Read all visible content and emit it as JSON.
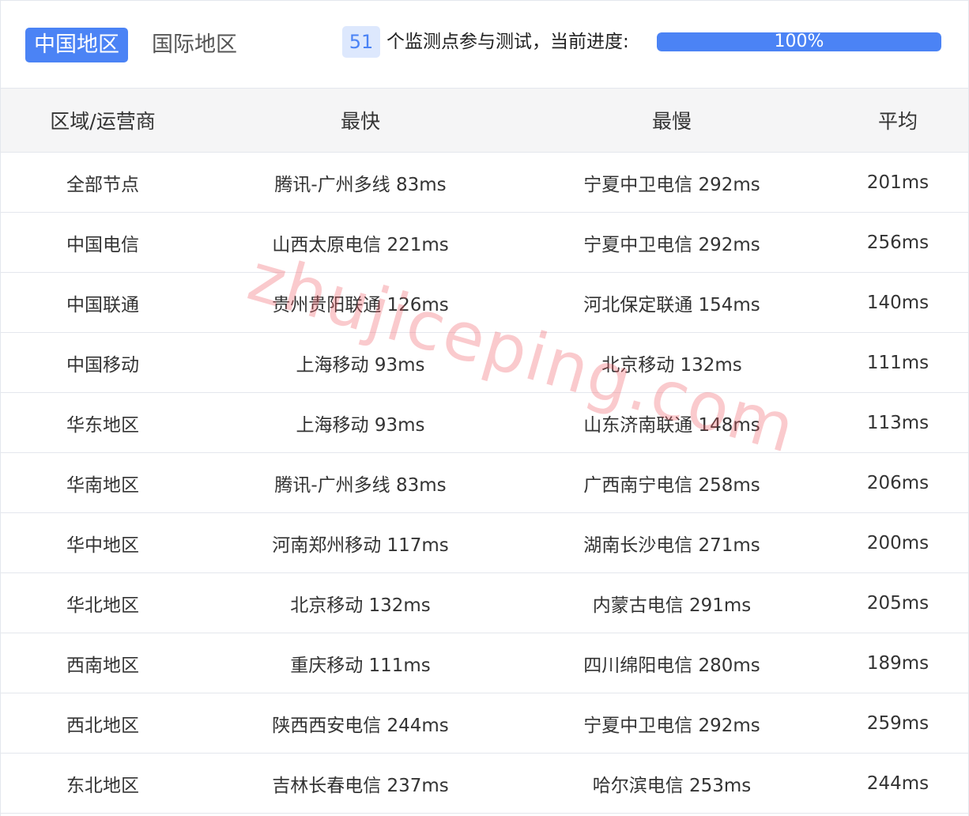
{
  "tabs": {
    "china_label": "中国地区",
    "international_label": "国际地区"
  },
  "status": {
    "monitor_count": "51",
    "text": "个监测点参与测试，当前进度:",
    "progress_percent": 100,
    "progress_label": "100%"
  },
  "table": {
    "headers": [
      "区域/运营商",
      "最快",
      "最慢",
      "平均"
    ],
    "rows": [
      {
        "region": "全部节点",
        "fastest": "腾讯-广州多线 83ms",
        "slowest": "宁夏中卫电信 292ms",
        "average": "201ms"
      },
      {
        "region": "中国电信",
        "fastest": "山西太原电信 221ms",
        "slowest": "宁夏中卫电信 292ms",
        "average": "256ms"
      },
      {
        "region": "中国联通",
        "fastest": "贵州贵阳联通 126ms",
        "slowest": "河北保定联通 154ms",
        "average": "140ms"
      },
      {
        "region": "中国移动",
        "fastest": "上海移动 93ms",
        "slowest": "北京移动 132ms",
        "average": "111ms"
      },
      {
        "region": "华东地区",
        "fastest": "上海移动 93ms",
        "slowest": "山东济南联通 148ms",
        "average": "113ms"
      },
      {
        "region": "华南地区",
        "fastest": "腾讯-广州多线 83ms",
        "slowest": "广西南宁电信 258ms",
        "average": "206ms"
      },
      {
        "region": "华中地区",
        "fastest": "河南郑州移动 117ms",
        "slowest": "湖南长沙电信 271ms",
        "average": "200ms"
      },
      {
        "region": "华北地区",
        "fastest": "北京移动 132ms",
        "slowest": "内蒙古电信 291ms",
        "average": "205ms"
      },
      {
        "region": "西南地区",
        "fastest": "重庆移动 111ms",
        "slowest": "四川绵阳电信 280ms",
        "average": "189ms"
      },
      {
        "region": "西北地区",
        "fastest": "陕西西安电信 244ms",
        "slowest": "宁夏中卫电信 292ms",
        "average": "259ms"
      },
      {
        "region": "东北地区",
        "fastest": "吉林长春电信 237ms",
        "slowest": "哈尔滨电信 253ms",
        "average": "244ms"
      }
    ]
  },
  "watermark": "zhujiceping.com",
  "colors": {
    "accent": "#4b83f5",
    "badge_bg": "#dde8fd",
    "header_bg": "#f5f5f6",
    "border": "#e4e7ed"
  }
}
